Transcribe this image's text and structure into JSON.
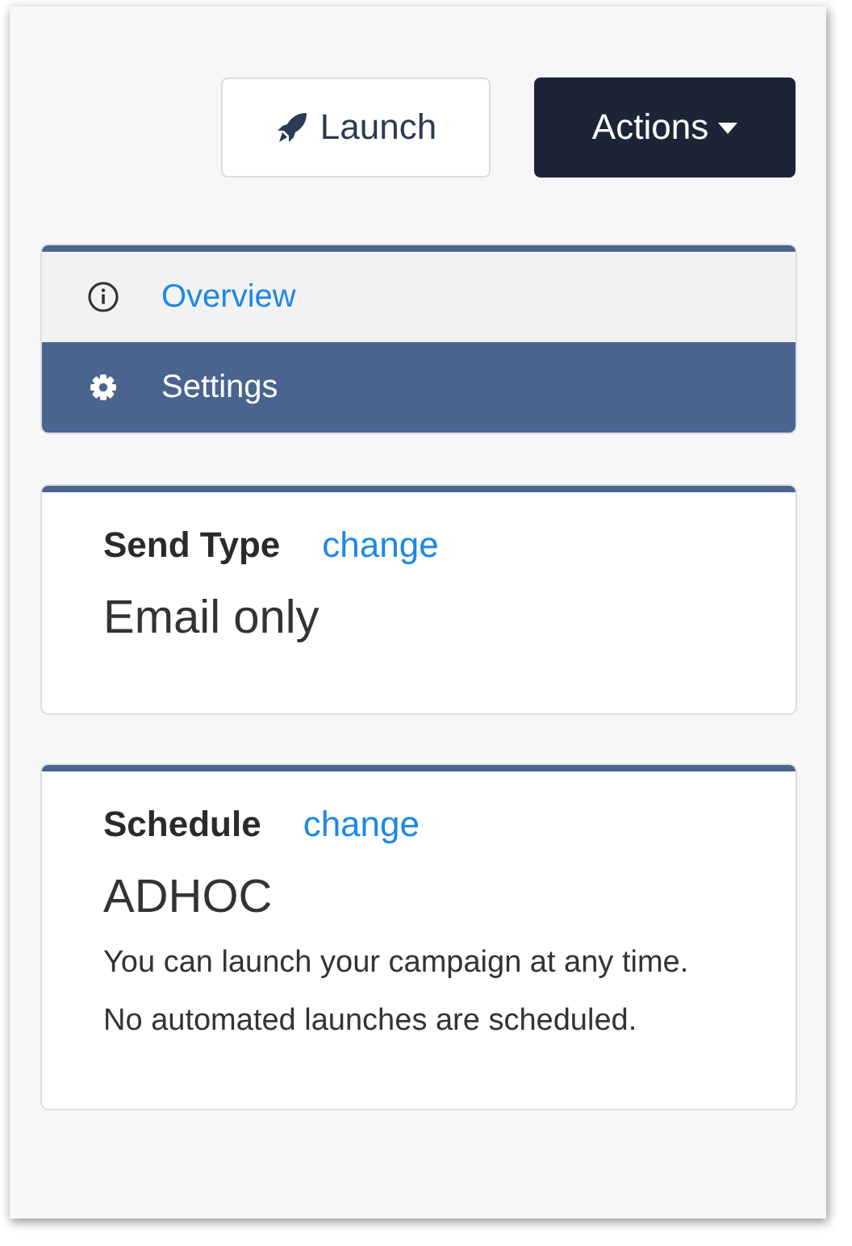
{
  "toolbar": {
    "launch_button": "Launch",
    "actions_button": "Actions"
  },
  "nav": [
    {
      "label": "Overview",
      "kind": "info",
      "selected": false
    },
    {
      "label": "Settings",
      "kind": "gear",
      "selected": true
    }
  ],
  "cards": [
    {
      "title": "Send Type",
      "link": "change",
      "value": "Email only"
    },
    {
      "title": "Schedule",
      "link": "change",
      "value": "ADHOC",
      "description": "You can launch your campaign at any time. No automated launches are scheduled."
    }
  ]
}
